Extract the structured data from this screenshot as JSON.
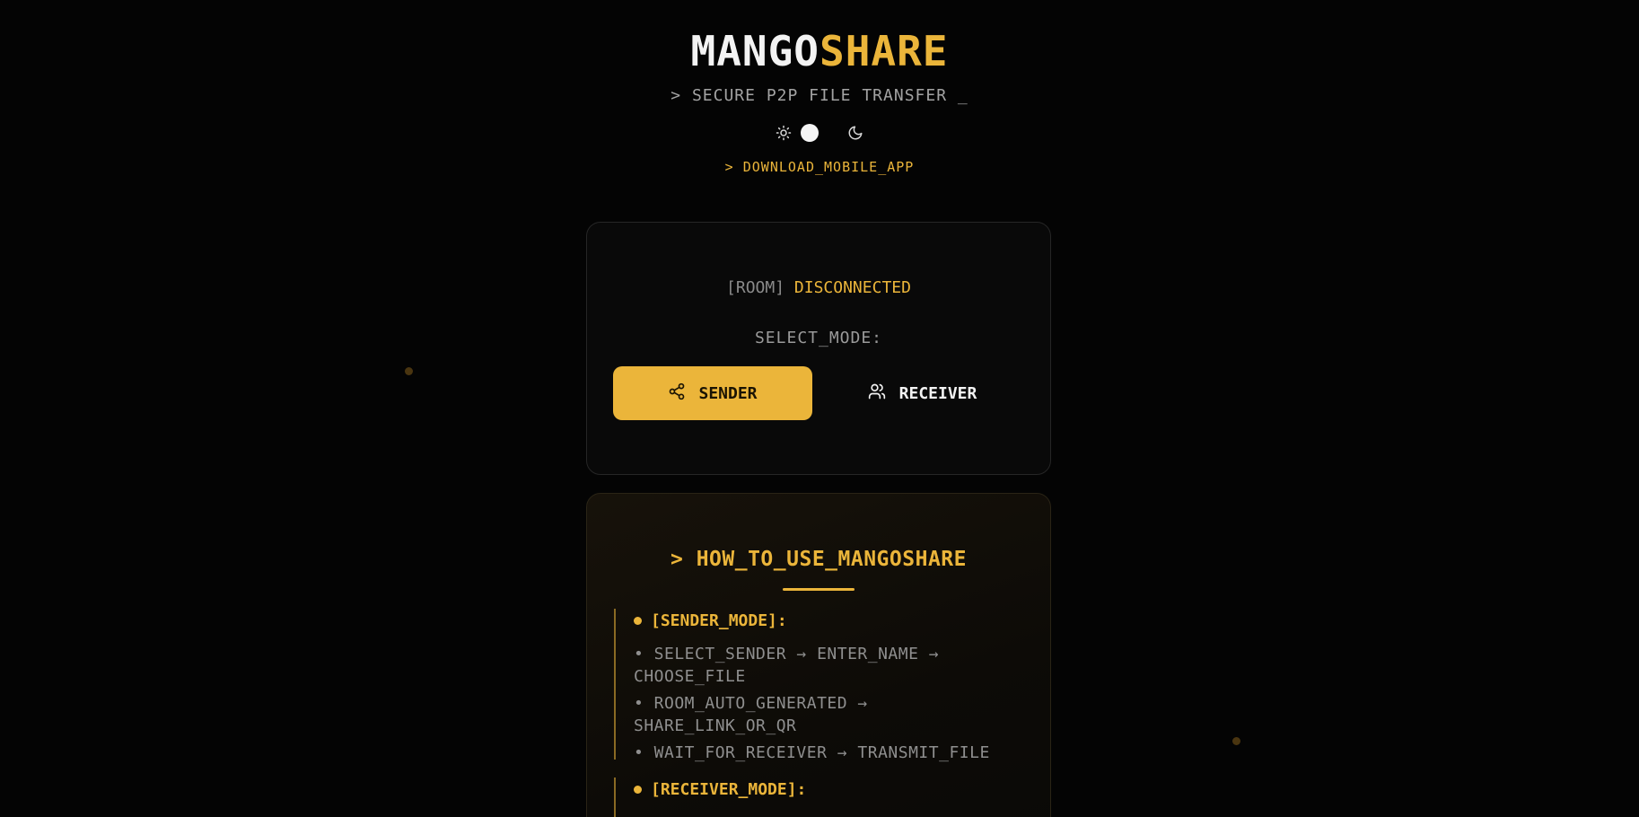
{
  "header": {
    "brand_part1": "MANGO",
    "brand_part2": "SHARE",
    "tagline": "> SECURE P2P FILE TRANSFER _",
    "download_link": "> DOWNLOAD_MOBILE_APP"
  },
  "theme": {
    "light_icon": "sun-icon",
    "dark_icon": "moon-icon",
    "current": "dark"
  },
  "room_card": {
    "status_label": "[ROOM]",
    "status_value": "DISCONNECTED",
    "select_mode_label": "SELECT_MODE:",
    "sender_button": "SENDER",
    "sender_icon": "share-icon",
    "receiver_button": "RECEIVER",
    "receiver_icon": "users-icon"
  },
  "how_to": {
    "title": "> HOW_TO_USE_MANGOSHARE",
    "sender_section": {
      "title": "[SENDER_MODE]:",
      "steps": [
        "• SELECT_SENDER → ENTER_NAME → CHOOSE_FILE",
        "• ROOM_AUTO_GENERATED → SHARE_LINK_OR_QR",
        "• WAIT_FOR_RECEIVER → TRANSMIT_FILE"
      ]
    },
    "receiver_section": {
      "title": "[RECEIVER_MODE]:"
    }
  },
  "colors": {
    "accent": "#ebb53a",
    "background": "#040404",
    "card": "#090909"
  }
}
